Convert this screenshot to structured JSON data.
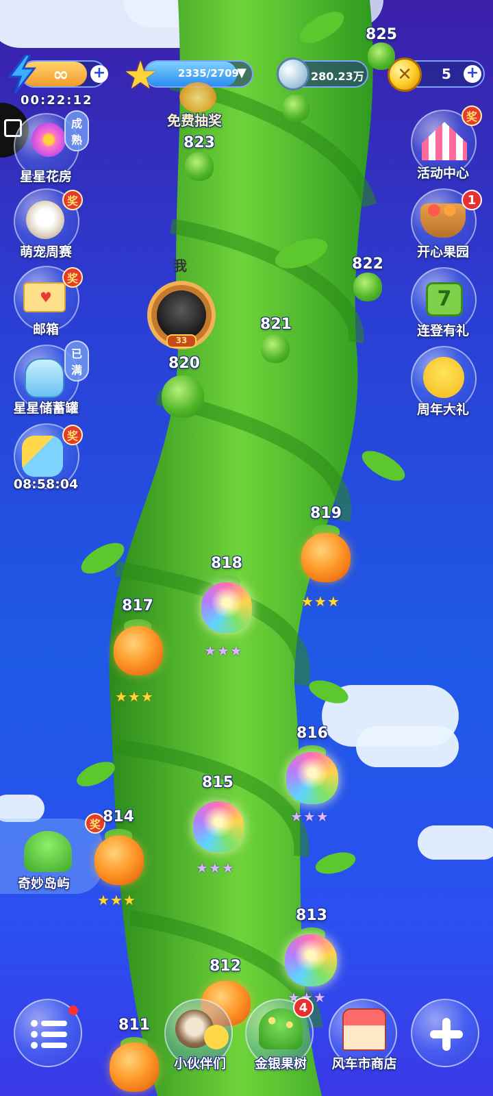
{
  "top_bar": {
    "energy": {
      "value": "∞",
      "timer": "00:22:12",
      "plus": "+"
    },
    "stars": {
      "progress": "2335/2709",
      "progress_fraction": 0.862
    },
    "free_draw_label": "免费抽奖",
    "silver": {
      "value": "280.23万"
    },
    "gold": {
      "value": "5",
      "plus": "+"
    }
  },
  "left_menu": [
    {
      "label": "星星花房",
      "badge": "成熟"
    },
    {
      "label": "萌宠周赛",
      "badge": "奖"
    },
    {
      "label": "邮箱",
      "badge": "奖"
    },
    {
      "label": "星星储蓄罐",
      "badge": "已满"
    },
    {
      "label": "",
      "badge": "奖",
      "timer": "08:58:04"
    }
  ],
  "right_menu": [
    {
      "label": "活动中心",
      "badge": "奖"
    },
    {
      "label": "开心果园",
      "badge": "1"
    },
    {
      "label": "连登有礼"
    },
    {
      "label": "周年大礼"
    }
  ],
  "island": {
    "label": "奇妙岛屿",
    "badge": "奖"
  },
  "player": {
    "marker": "我",
    "level_badge": "33"
  },
  "levels": [
    {
      "num": "811",
      "type": "orange",
      "stars": ""
    },
    {
      "num": "812",
      "type": "orange",
      "stars": ""
    },
    {
      "num": "813",
      "type": "rainbow",
      "stars": "★★★"
    },
    {
      "num": "814",
      "type": "orange",
      "stars": "★★★"
    },
    {
      "num": "815",
      "type": "rainbow",
      "stars": "★★★"
    },
    {
      "num": "816",
      "type": "rainbow",
      "stars": "★★★"
    },
    {
      "num": "817",
      "type": "orange",
      "stars": "★★★"
    },
    {
      "num": "818",
      "type": "rainbow",
      "stars": "★★★"
    },
    {
      "num": "819",
      "type": "orange",
      "stars": "★★★"
    },
    {
      "num": "820",
      "type": "green",
      "stars": ""
    },
    {
      "num": "821",
      "type": "green",
      "stars": ""
    },
    {
      "num": "822",
      "type": "green",
      "stars": ""
    },
    {
      "num": "823",
      "type": "green",
      "stars": ""
    },
    {
      "num": "825",
      "type": "green",
      "stars": ""
    }
  ],
  "bottom_bar": {
    "menu_icon": "list-icon",
    "partners": "小伙伴们",
    "money_tree": {
      "label": "金银果树",
      "badge": "4"
    },
    "shop": "风车市商店",
    "add_icon": "plus-icon"
  },
  "colors": {
    "sky_top": "#3b1fa8",
    "sky_bottom": "#3a39e6",
    "stalk": "#3fae2a",
    "badge_red": "#e63a2e"
  }
}
